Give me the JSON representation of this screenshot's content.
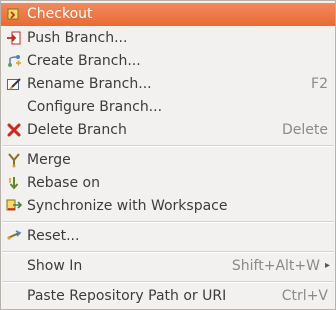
{
  "menu": {
    "items": {
      "checkout": {
        "label": "Checkout",
        "icon": "checkout-icon"
      },
      "push": {
        "label": "Push Branch...",
        "icon": "push-branch-icon"
      },
      "create": {
        "label": "Create Branch...",
        "icon": "create-branch-icon"
      },
      "rename": {
        "label": "Rename Branch...",
        "shortcut": "F2",
        "icon": "rename-branch-icon"
      },
      "configure": {
        "label": "Configure Branch..."
      },
      "delete": {
        "label": "Delete Branch",
        "shortcut": "Delete",
        "icon": "delete-icon"
      },
      "merge": {
        "label": "Merge",
        "icon": "merge-icon"
      },
      "rebase": {
        "label": "Rebase on",
        "icon": "rebase-icon"
      },
      "synchronize": {
        "label": "Synchronize with Workspace",
        "icon": "synchronize-icon"
      },
      "reset": {
        "label": "Reset...",
        "icon": "reset-icon"
      },
      "show_in": {
        "label": "Show In",
        "shortcut": "Shift+Alt+W",
        "submenu_glyph": "▸"
      },
      "paste_path": {
        "label": "Paste Repository Path or URI",
        "shortcut": "Ctrl+V"
      }
    }
  },
  "colors": {
    "highlight": "#e96a34",
    "background": "#f2f1f0",
    "text": "#3c3c3c",
    "shortcut_text": "#8a8a8a"
  }
}
